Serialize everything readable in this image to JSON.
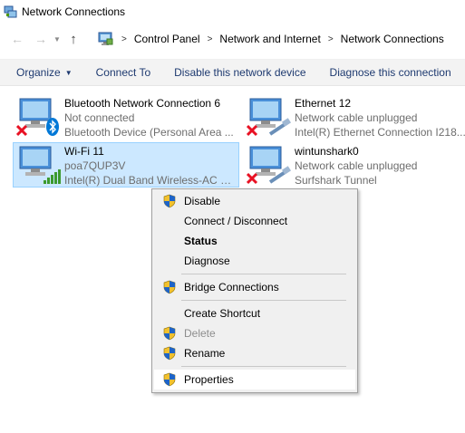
{
  "window": {
    "title": "Network Connections",
    "icon": "network-connections-icon"
  },
  "nav": {
    "back_icon": "arrow-left-icon",
    "forward_icon": "arrow-right-icon",
    "recent_icon": "chevron-down-icon",
    "up_icon": "arrow-up-icon"
  },
  "breadcrumb": [
    "Control Panel",
    "Network and Internet",
    "Network Connections"
  ],
  "toolbar": {
    "organize": "Organize",
    "connect_to": "Connect To",
    "disable_device": "Disable this network device",
    "diagnose": "Diagnose this connection"
  },
  "connections": [
    {
      "name": "Bluetooth Network Connection 6",
      "status": "Not connected",
      "device": "Bluetooth Device (Personal Area ...",
      "icon": "bluetooth-icon"
    },
    {
      "name": "Ethernet 12",
      "status": "Network cable unplugged",
      "device": "Intel(R) Ethernet Connection I218...",
      "icon": "ethernet-cable-icon"
    },
    {
      "name": "Wi-Fi 11",
      "status": "poa7QUP3V",
      "device": "Intel(R) Dual Band Wireless-AC 72...",
      "icon": "wifi-signal-icon"
    },
    {
      "name": "wintunshark0",
      "status": "Network cable unplugged",
      "device": "Surfshark Tunnel",
      "icon": "ethernet-cable-icon"
    }
  ],
  "context_menu": {
    "items": [
      "Disable",
      "Connect / Disconnect",
      "Status",
      "Diagnose",
      "Bridge Connections",
      "Create Shortcut",
      "Delete",
      "Rename",
      "Properties"
    ]
  },
  "colors": {
    "selection_bg": "#cce8ff",
    "toolbar_text": "#1e3a70",
    "error_red": "#e81123",
    "bluetooth_blue": "#0078d7",
    "signal_green": "#3c9a2e"
  }
}
